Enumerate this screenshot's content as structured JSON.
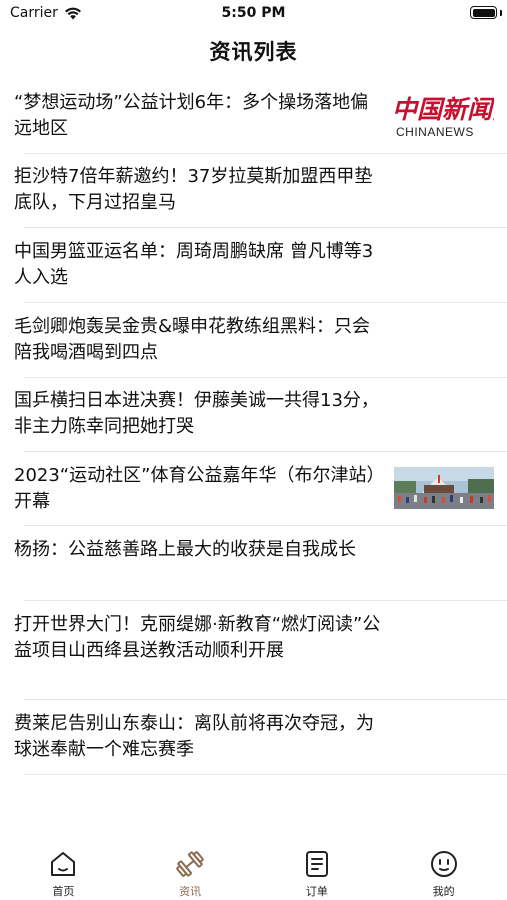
{
  "status_bar": {
    "carrier": "Carrier",
    "time": "5:50 PM"
  },
  "nav": {
    "title": "资讯列表"
  },
  "news": [
    {
      "title": "“梦想运动场”公益计划6年：多个操场落地偏远地区",
      "thumb": "chinanews-logo",
      "logo_text": "中国新闻网",
      "logo_sub": "CHINANEWS"
    },
    {
      "title": "拒沙特7倍年薪邀约！37岁拉莫斯加盟西甲垫底队，下月过招皇马"
    },
    {
      "title": "中国男篮亚运名单：周琦周鹏缺席 曾凡博等3人入选"
    },
    {
      "title": "毛剑卿炮轰吴金贵&曝申花教练组黑料：只会陪我喝酒喝到四点"
    },
    {
      "title": "国乒横扫日本进决赛！伊藤美诚一共得13分，非主力陈幸同把她打哭"
    },
    {
      "title": "2023“运动社区”体育公益嘉年华（布尔津站）开幕",
      "thumb": "event-photo"
    },
    {
      "title": "杨扬：公益慈善路上最大的收获是自我成长"
    },
    {
      "title": "打开世界大门！克丽缇娜·新教育“燃灯阅读”公益项目山西绛县送教活动顺利开展"
    },
    {
      "title": "费莱尼告别山东泰山：离队前将再次夺冠，为球迷奉献一个难忘赛季"
    }
  ],
  "tabs": [
    {
      "label": "首页",
      "icon": "home-icon",
      "active": false
    },
    {
      "label": "资讯",
      "icon": "dumbbell-icon",
      "active": true
    },
    {
      "label": "订单",
      "icon": "order-list-icon",
      "active": false
    },
    {
      "label": "我的",
      "icon": "smiley-face-icon",
      "active": false
    }
  ],
  "colors": {
    "active_tab": "#8c6b4e",
    "divider": "#e6e6e6",
    "text": "#111111"
  }
}
